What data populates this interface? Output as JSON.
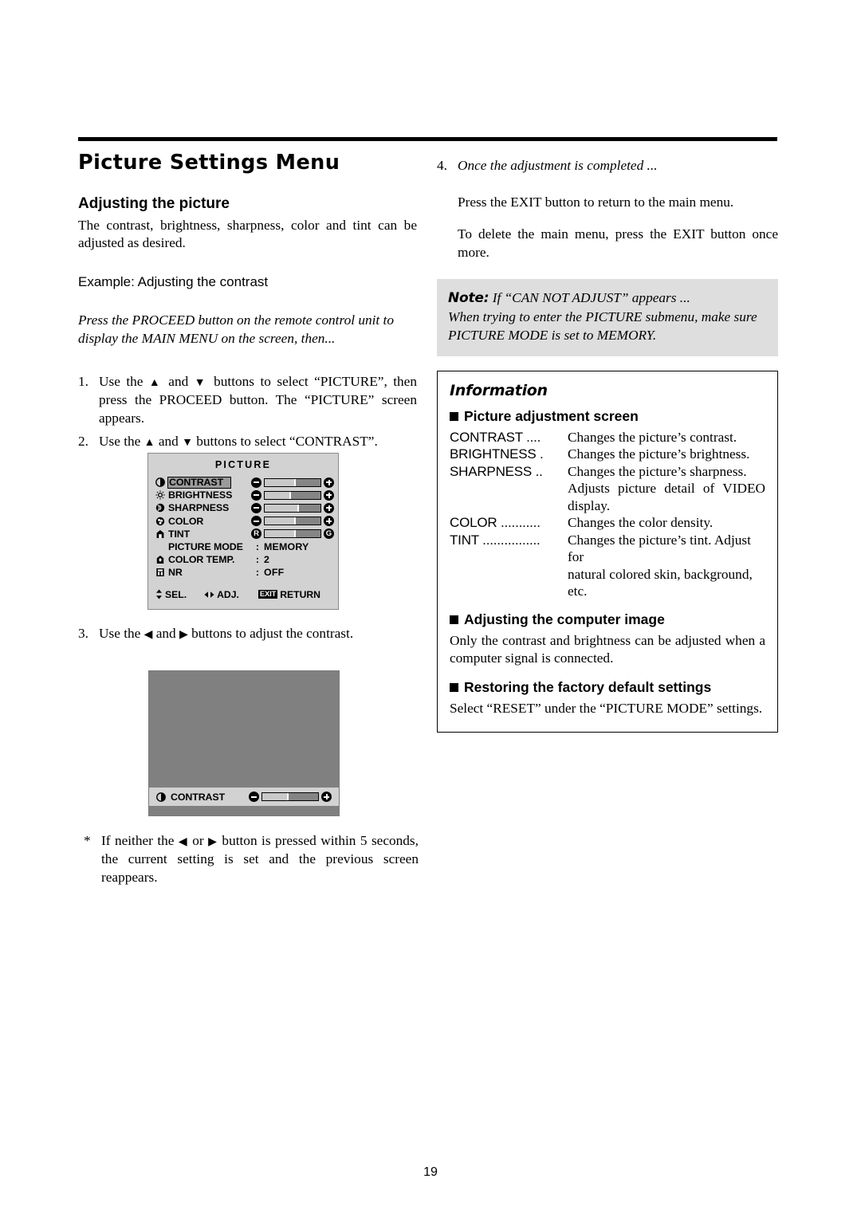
{
  "page": {
    "number": "19"
  },
  "left_column": {
    "main_heading": "Picture Settings Menu",
    "sub_heading": "Adjusting the picture",
    "intro": "The contrast, brightness, sharpness, color and tint can be adjusted as desired.",
    "example_line": "Example: Adjusting the contrast",
    "press_proceed": "Press the PROCEED button on the remote control unit to display the MAIN MENU on the screen, then...",
    "steps": [
      {
        "num": "1.",
        "pre": "Use the ",
        "up": "▲",
        "mid": " and ",
        "down": "▼",
        "post": " buttons to select “PICTURE”, then press the PROCEED button. The “PICTURE” screen appears."
      },
      {
        "num": "2.",
        "pre": "Use the ",
        "up": "▲",
        "mid": " and ",
        "down": "▼",
        "post": " buttons to select “CONTRAST”."
      },
      {
        "num": "3.",
        "pre": "Use the ",
        "left": "◀",
        "mid": " and ",
        "right": "▶",
        "post": " buttons to adjust the contrast."
      }
    ],
    "footnote": {
      "star": "*",
      "pre": "If neither the ",
      "left": "◀",
      "mid": " or ",
      "right": "▶",
      "post": " button is pressed within 5 seconds, the current setting is set and the previous screen reappears."
    }
  },
  "osd_picture": {
    "title": "PICTURE",
    "rows": [
      {
        "icon": "contrast-icon",
        "label": "CONTRAST",
        "type": "slider",
        "highlighted": true,
        "minus": "minus",
        "plus": "plus",
        "fill": 56
      },
      {
        "icon": "brightness-icon",
        "label": "BRIGHTNESS",
        "type": "slider",
        "highlighted": false,
        "minus": "minus",
        "plus": "plus",
        "fill": 47
      },
      {
        "icon": "sharpness-icon",
        "label": "SHARPNESS",
        "type": "slider",
        "highlighted": false,
        "minus": "minus",
        "plus": "plus",
        "fill": 62
      },
      {
        "icon": "color-icon",
        "label": "COLOR",
        "type": "slider",
        "highlighted": false,
        "minus": "minus",
        "plus": "plus",
        "fill": 55
      },
      {
        "icon": "tint-icon",
        "label": "TINT",
        "type": "slider",
        "highlighted": false,
        "minus": "R",
        "plus": "G",
        "fill": 55
      },
      {
        "icon": "",
        "label": "PICTURE MODE",
        "type": "value",
        "colon": ":",
        "value": "MEMORY"
      },
      {
        "icon": "color-temp-icon",
        "label": "COLOR TEMP.",
        "type": "value",
        "colon": ":",
        "value": "2"
      },
      {
        "icon": "nr-icon",
        "label": "NR",
        "type": "value",
        "colon": ":",
        "value": "OFF"
      }
    ],
    "footer": {
      "sel_arrows": "⬍",
      "sel_label": "SEL.",
      "adj_arrows": "⬌",
      "adj_label": "ADJ.",
      "exit_badge": "EXIT",
      "return_label": "RETURN"
    }
  },
  "osd_contrast": {
    "icon": "contrast-icon",
    "label": "CONTRAST",
    "minus": "minus",
    "plus": "plus",
    "fill": 47
  },
  "right_column": {
    "step4": {
      "num": "4.",
      "title": "Once the adjustment is completed ...",
      "line1": "Press the EXIT button to return to the main menu.",
      "line2": "To delete the main menu, press the EXIT button once more."
    },
    "note": {
      "word": "Note:",
      "headline": " If “CAN NOT ADJUST” appears ...",
      "body": "When trying to enter the PICTURE submenu, make sure PICTURE MODE is set to MEMORY."
    },
    "information": {
      "title": "Information",
      "section1": {
        "heading": "Picture adjustment screen",
        "definitions": [
          {
            "term": "CONTRAST ....",
            "desc": "Changes the picture’s contrast."
          },
          {
            "term": "BRIGHTNESS .",
            "desc": "Changes the picture’s brightness."
          },
          {
            "term": "SHARPNESS ..",
            "desc": "Changes the picture’s sharpness.",
            "cont": "Adjusts picture detail of VIDEO display."
          },
          {
            "term": "COLOR ...........",
            "desc": "Changes the color density."
          },
          {
            "term": "TINT ................",
            "desc": "Changes the picture’s tint. Adjust for",
            "cont": "natural colored skin, background, etc."
          }
        ]
      },
      "section2": {
        "heading": "Adjusting the computer image",
        "body": "Only the contrast and brightness can be adjusted when a computer signal is connected."
      },
      "section3": {
        "heading": "Restoring the factory default settings",
        "body": "Select “RESET” under the “PICTURE MODE” settings."
      }
    }
  }
}
